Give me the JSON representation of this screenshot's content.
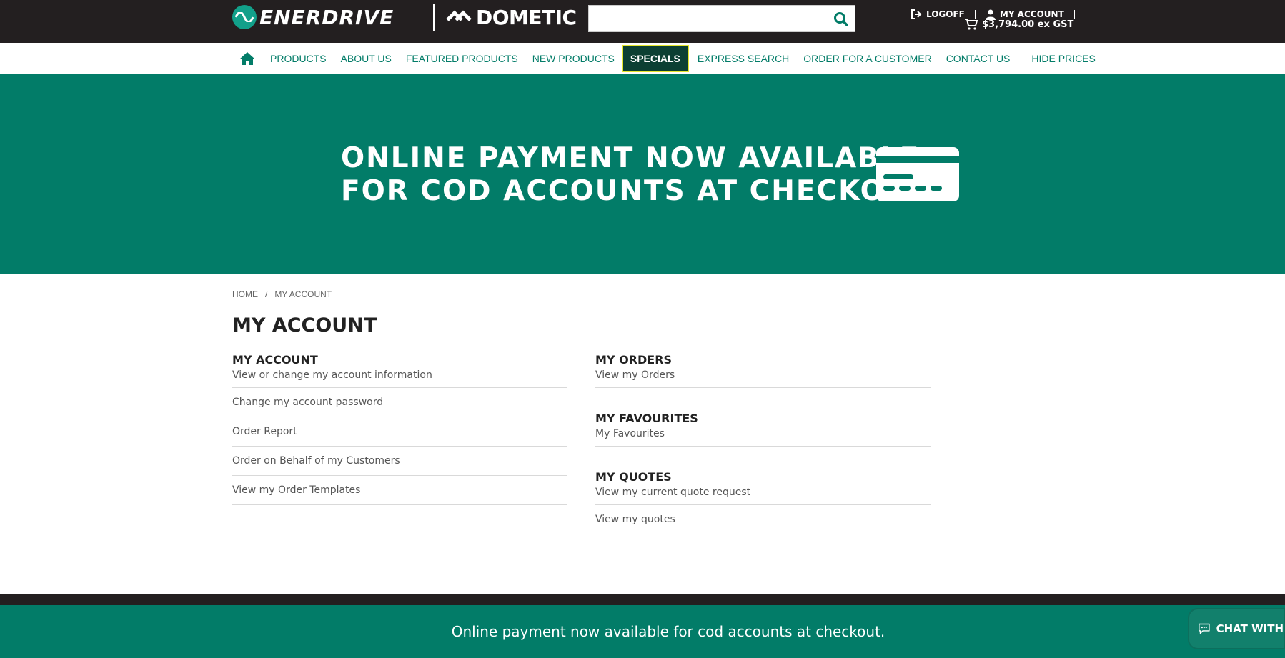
{
  "header": {
    "brand_1": "ENERDRIVE",
    "brand_2": "DOMETIC",
    "search": {
      "value": "",
      "placeholder": ""
    },
    "logoff_label": "LOGOFF",
    "my_account_label": "MY ACCOUNT",
    "cart_total": "$3,794.00 ex GST"
  },
  "nav": {
    "items": [
      {
        "label": "PRODUCTS"
      },
      {
        "label": "ABOUT US"
      },
      {
        "label": "FEATURED PRODUCTS"
      },
      {
        "label": "NEW PRODUCTS"
      },
      {
        "label": "SPECIALS"
      },
      {
        "label": "EXPRESS SEARCH"
      },
      {
        "label": "ORDER FOR A CUSTOMER"
      },
      {
        "label": "CONTACT US"
      },
      {
        "label": "HIDE PRICES"
      }
    ]
  },
  "banner": {
    "line1": "ONLINE PAYMENT NOW AVAILABLE",
    "line2": "FOR COD ACCOUNTS AT CHECKOUT"
  },
  "breadcrumb": {
    "home": "HOME",
    "sep": "/",
    "current": "MY ACCOUNT"
  },
  "page_title": "MY ACCOUNT",
  "account": {
    "title": "MY ACCOUNT",
    "links": [
      "View or change my account information",
      "Change my account password",
      "Order Report",
      "Order on Behalf of my Customers",
      "View my Order Templates"
    ]
  },
  "orders": {
    "title": "MY ORDERS",
    "links": [
      "View my Orders"
    ]
  },
  "favourites": {
    "title": "MY FAVOURITES",
    "links": [
      "My Favourites"
    ]
  },
  "quotes": {
    "title": "MY QUOTES",
    "links": [
      "View my current quote request",
      "View my quotes"
    ]
  },
  "footer": {
    "message": "Online payment now available for cod accounts at checkout."
  },
  "chat": {
    "label": "CHAT WITH"
  },
  "colors": {
    "brand_green": "#027c68",
    "dark": "#231f20",
    "special_bg": "#0c3f33",
    "special_border": "#e6e62b"
  }
}
